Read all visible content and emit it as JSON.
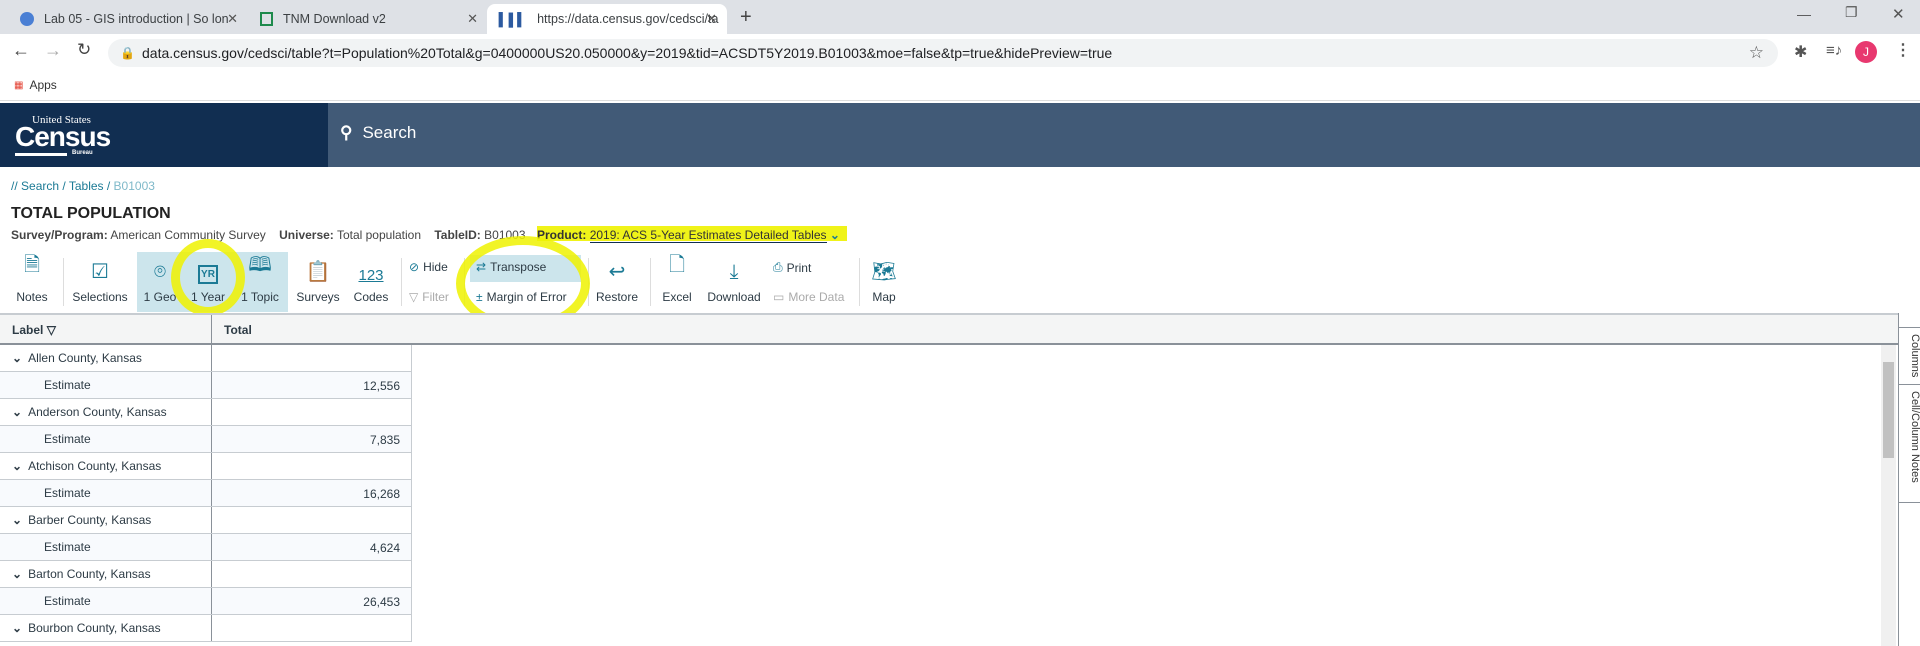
{
  "browser": {
    "tabs": [
      {
        "title": "Lab 05 - GIS introduction | So lon",
        "icon": "docs-icon"
      },
      {
        "title": "TNM Download v2",
        "icon": "tnm-icon"
      },
      {
        "title": "https://data.census.gov/cedsci/ta",
        "icon": "census-chart-icon",
        "active": true
      }
    ],
    "url": "data.census.gov/cedsci/table?t=Population%20Total&g=0400000US20.050000&y=2019&tid=ACSDT5Y2019.B01003&moe=false&tp=true&hidePreview=true",
    "bookmarks": {
      "apps": "Apps"
    },
    "profile_initial": "J",
    "profile_color": "#e8386f"
  },
  "site": {
    "logo_top": "United States",
    "logo_main": "Census",
    "logo_bottom": "Bureau",
    "search_label": "Search"
  },
  "breadcrumb": {
    "prefix": "//",
    "items": [
      "Search",
      "Tables",
      "B01003"
    ]
  },
  "table_title": "TOTAL POPULATION",
  "meta": {
    "survey_label": "Survey/Program:",
    "survey": "American Community Survey",
    "universe_label": "Universe:",
    "universe": "Total population",
    "tableid_label": "TableID:",
    "tableid": "B01003",
    "product_label": "Product:",
    "product": "2019: ACS 5-Year Estimates Detailed Tables"
  },
  "toolbar": {
    "notes": "Notes",
    "selections": "Selections",
    "geo": "1 Geo",
    "year": "1 Year",
    "topic": "1 Topic",
    "surveys": "Surveys",
    "codes": "Codes",
    "codes_icon": "123",
    "hide": "Hide",
    "filter": "Filter",
    "transpose": "Transpose",
    "moe": "Margin of Error",
    "restore": "Restore",
    "excel": "Excel",
    "download": "Download",
    "print": "Print",
    "more_data": "More Data",
    "map": "Map",
    "year_icon": "YR"
  },
  "grid": {
    "col_label": "Label",
    "col_total": "Total",
    "rows": [
      {
        "county": "Allen County, Kansas",
        "label": "Estimate",
        "value": "12,556"
      },
      {
        "county": "Anderson County, Kansas",
        "label": "Estimate",
        "value": "7,835"
      },
      {
        "county": "Atchison County, Kansas",
        "label": "Estimate",
        "value": "16,268"
      },
      {
        "county": "Barber County, Kansas",
        "label": "Estimate",
        "value": "4,624"
      },
      {
        "county": "Barton County, Kansas",
        "label": "Estimate",
        "value": "26,453"
      },
      {
        "county": "Bourbon County, Kansas"
      }
    ]
  },
  "side_panel": {
    "columns": "Columns",
    "notes": "Cell/Column Notes"
  },
  "colors": {
    "census_navy": "#112e51",
    "search_bar": "#415a77",
    "accent": "#1b7a95",
    "highlight": "#eef200"
  }
}
